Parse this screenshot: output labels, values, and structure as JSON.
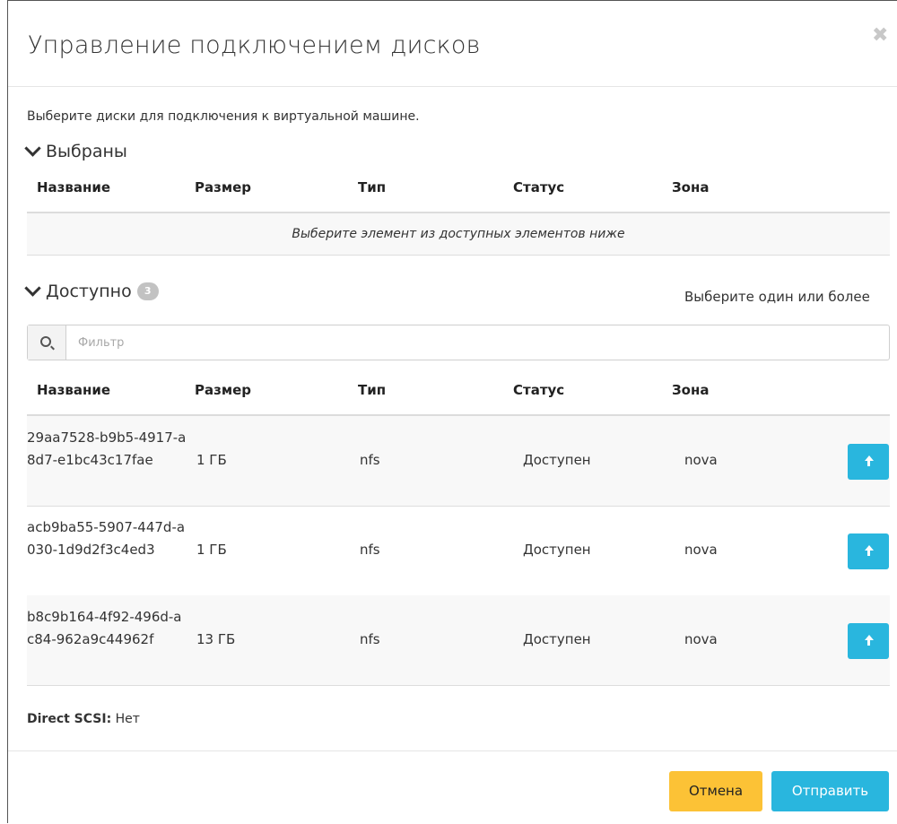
{
  "modal": {
    "title": "Управление подключением дисков",
    "intro": "Выберите диски для подключения к виртуальной машине."
  },
  "selected": {
    "heading": "Выбраны",
    "columns": [
      "Название",
      "Размер",
      "Тип",
      "Статус",
      "Зона"
    ],
    "empty_text": "Выберите элемент из доступных элементов ниже"
  },
  "available": {
    "heading": "Доступно",
    "count": "3",
    "hint": "Выберите один или более",
    "filter_placeholder": "Фильтр",
    "columns": [
      "Название",
      "Размер",
      "Тип",
      "Статус",
      "Зона"
    ],
    "rows": [
      {
        "name": "29aa7528-b9b5-4917-a8d7-e1bc43c17fae",
        "size": "1 ГБ",
        "type": "nfs",
        "status": "Доступен",
        "zone": "nova"
      },
      {
        "name": "acb9ba55-5907-447d-a030-1d9d2f3c4ed3",
        "size": "1 ГБ",
        "type": "nfs",
        "status": "Доступен",
        "zone": "nova"
      },
      {
        "name": "b8c9b164-4f92-496d-ac84-962a9c44962f",
        "size": "13 ГБ",
        "type": "nfs",
        "status": "Доступен",
        "zone": "nova"
      }
    ]
  },
  "scsi": {
    "label": "Direct SCSI:",
    "value": "Нет"
  },
  "footer": {
    "cancel": "Отмена",
    "submit": "Отправить"
  },
  "colors": {
    "primary": "#29b6de",
    "warning": "#fcc236",
    "badge": "#c2c2c2"
  }
}
